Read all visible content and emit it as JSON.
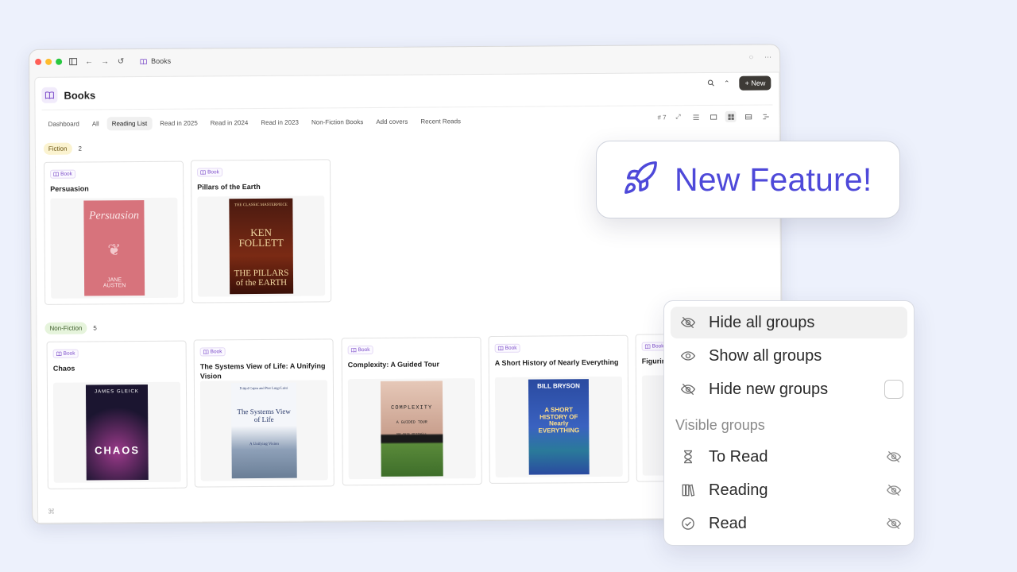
{
  "window": {
    "title": "Books",
    "page_title": "Books",
    "new_button": "+ New"
  },
  "tabs": [
    {
      "label": "Dashboard",
      "active": false
    },
    {
      "label": "All",
      "active": false
    },
    {
      "label": "Reading List",
      "active": true
    },
    {
      "label": "Read in 2025",
      "active": false
    },
    {
      "label": "Read in 2024",
      "active": false
    },
    {
      "label": "Read in 2023",
      "active": false
    },
    {
      "label": "Non-Fiction Books",
      "active": false
    },
    {
      "label": "Add covers",
      "active": false
    },
    {
      "label": "Recent Reads",
      "active": false
    }
  ],
  "view_tools": {
    "count_label": "# 7"
  },
  "groups": {
    "fiction": {
      "label": "Fiction",
      "count": "2"
    },
    "nonfiction": {
      "label": "Non-Fiction",
      "count": "5"
    }
  },
  "badge_label": "Book",
  "books": [
    {
      "title": "Persuasion",
      "cover_lines": [
        "Persuasion",
        "JANE AUSTEN"
      ],
      "cover_color": "#d7737c"
    },
    {
      "title": "Pillars of the Earth",
      "cover_lines": [
        "THE CLASSIC MASTERPIECE",
        "KEN FOLLETT",
        "THE PILLARS of the EARTH"
      ],
      "cover_color": "#5a1c12"
    },
    {
      "title": "Chaos",
      "cover_lines": [
        "JAMES GLEICK",
        "CHAOS"
      ],
      "cover_color": "#1b1530"
    },
    {
      "title": "The Systems View of Life: A Unifying Vision",
      "cover_lines": [
        "Fritjof Capra and Pier Luigi Luisi",
        "The Systems View of Life",
        "A Unifying Vision"
      ],
      "cover_color": "#e8ecf2"
    },
    {
      "title": "Complexity: A Guided Tour",
      "cover_lines": [
        "COMPLEXITY",
        "A GUIDED TOUR",
        "MELANIE MITCHELL"
      ],
      "cover_color": "#d9b7a8"
    },
    {
      "title": "A Short History of Nearly Everything",
      "cover_lines": [
        "BILL BRYSON",
        "A SHORT HISTORY OF Nearly EVERYTHING"
      ],
      "cover_color": "#2f4fa8"
    },
    {
      "title": "Figurin",
      "cover_lines": [],
      "cover_color": "#f6f6f6"
    }
  ],
  "feature": {
    "text": "New Feature!"
  },
  "menu": {
    "hide_all": "Hide all groups",
    "show_all": "Show all groups",
    "hide_new": "Hide new groups",
    "section": "Visible groups",
    "items": [
      {
        "label": "To Read",
        "icon": "hourglass-icon"
      },
      {
        "label": "Reading",
        "icon": "books-icon"
      },
      {
        "label": "Read",
        "icon": "check-circle-icon"
      }
    ]
  },
  "colors": {
    "accent": "#4e49d9",
    "book_badge": "#7b4bc9"
  }
}
